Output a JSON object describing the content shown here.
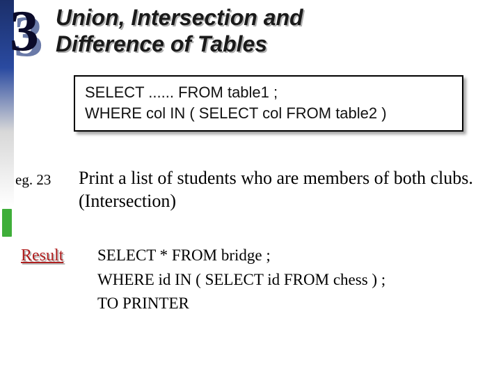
{
  "section_number": "3",
  "title_line1": "Union, Intersection and",
  "title_line2": "Difference of Tables",
  "sql_box": {
    "line1": "SELECT ...... FROM table1 ;",
    "line2": "WHERE col IN  ( SELECT col FROM table2 )"
  },
  "example": {
    "label": "eg. 23",
    "text": "Print a list of students who are members of both clubs. (Intersection)"
  },
  "result": {
    "label": "Result",
    "line1": "SELECT * FROM bridge ;",
    "line2": "WHERE id IN ( SELECT id FROM chess ) ;",
    "line3": "TO PRINTER"
  }
}
